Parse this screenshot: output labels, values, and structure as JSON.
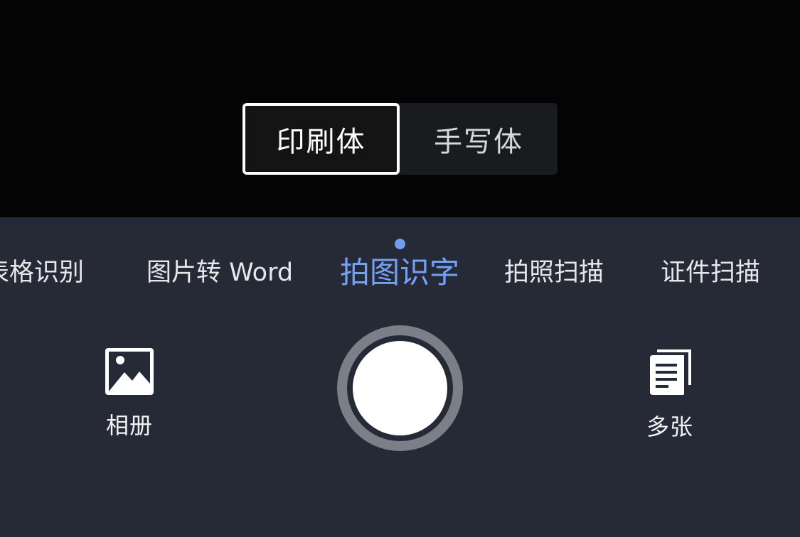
{
  "font_toggle": {
    "options": [
      "印刷体",
      "手写体"
    ],
    "selected": "印刷体"
  },
  "modes": {
    "items": [
      "表格识别",
      "图片转 Word",
      "拍图识字",
      "拍照扫描",
      "证件扫描"
    ],
    "current": "拍图识字"
  },
  "controls": {
    "album_label": "相册",
    "multi_label": "多张",
    "album_icon": "image-icon",
    "multi_icon": "multi-document-icon",
    "shutter_icon": "shutter-icon"
  },
  "colors": {
    "accent": "#74a1f4",
    "panel": "#252a36",
    "viewfinder": "#040404"
  }
}
